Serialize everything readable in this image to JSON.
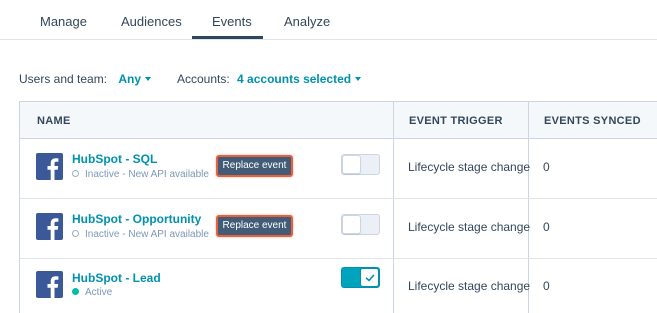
{
  "tabs": [
    {
      "label": "Manage",
      "active": false
    },
    {
      "label": "Audiences",
      "active": false
    },
    {
      "label": "Events",
      "active": true
    },
    {
      "label": "Analyze",
      "active": false
    }
  ],
  "filters": {
    "users_label": "Users and team:",
    "users_value": "Any",
    "accounts_label": "Accounts:",
    "accounts_value": "4 accounts selected"
  },
  "table": {
    "headers": {
      "name": "NAME",
      "trigger": "EVENT TRIGGER",
      "synced": "EVENTS SYNCED"
    },
    "rows": [
      {
        "name": "HubSpot - SQL",
        "status": "Inactive - New API available",
        "active": false,
        "replace_label": "Replace event",
        "trigger": "Lifecycle stage change",
        "synced": "0",
        "icon": "facebook-icon"
      },
      {
        "name": "HubSpot - Opportunity",
        "status": "Inactive - New API available",
        "active": false,
        "replace_label": "Replace event",
        "trigger": "Lifecycle stage change",
        "synced": "0",
        "icon": "facebook-icon"
      },
      {
        "name": "HubSpot - Lead",
        "status": "Active",
        "active": true,
        "trigger": "Lifecycle stage change",
        "synced": "0",
        "icon": "facebook-icon"
      }
    ]
  },
  "colors": {
    "link": "#0091ae",
    "active_dot": "#00bda5",
    "toggle_on": "#00a4bd",
    "replace_button": "#425b76",
    "highlight_border": "#e8613e",
    "facebook": "#3b5998"
  }
}
